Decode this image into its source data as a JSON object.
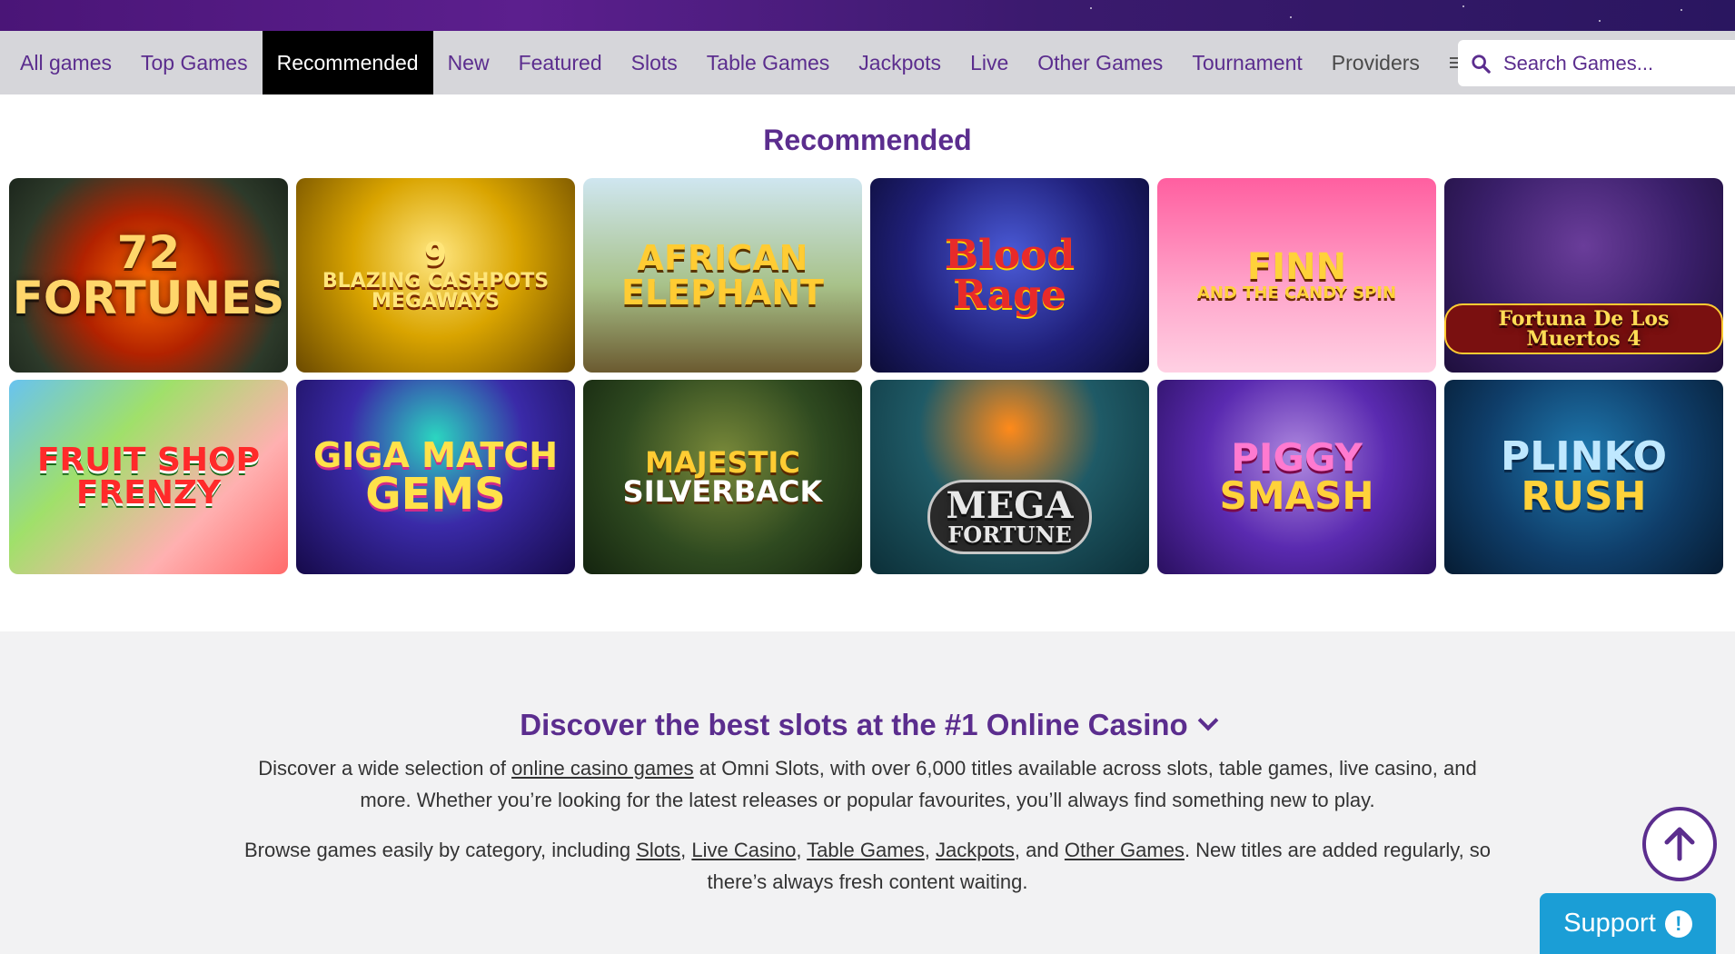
{
  "nav": {
    "items": [
      "All games",
      "Top Games",
      "Recommended",
      "New",
      "Featured",
      "Slots",
      "Table Games",
      "Jackpots",
      "Live",
      "Other Games",
      "Tournament"
    ],
    "active": "Recommended",
    "providers": "Providers"
  },
  "search": {
    "placeholder": "Search Games..."
  },
  "section": {
    "title": "Recommended"
  },
  "games": [
    {
      "title": "72",
      "sub": "FORTUNES"
    },
    {
      "title": "9",
      "sub": "BLAZING CASHPOTS MEGAWAYS"
    },
    {
      "title": "AFRICAN",
      "sub": "ELEPHANT"
    },
    {
      "title": "Blood Rage",
      "sub": ""
    },
    {
      "title": "FINN",
      "sub": "AND THE CANDY SPIN"
    },
    {
      "title": "Fortuna De Los Muertos 4",
      "sub": ""
    },
    {
      "title": "FRUIT SHOP",
      "sub": "FRENZY"
    },
    {
      "title": "GIGA MATCH",
      "sub": "GEMS"
    },
    {
      "title": "MAJESTIC",
      "sub": "SILVERBACK"
    },
    {
      "title": "MEGA",
      "sub": "FORTUNE"
    },
    {
      "title": "PIGGY",
      "sub": "SMASH"
    },
    {
      "title": "PLINKO",
      "sub": "RUSH"
    }
  ],
  "discover": {
    "heading": "Discover the best slots at the #1 Online Casino",
    "p1_a": "Discover a wide selection of ",
    "p1_link": "online casino games",
    "p1_b": " at Omni Slots, with over 6,000 titles available across slots, table games, live casino, and more. Whether you’re looking for the latest releases or popular favourites, you’ll always find something new to play.",
    "p2_a": "Browse games easily by category, including ",
    "p2_links": [
      "Slots",
      "Live Casino",
      "Table Games",
      "Jackpots",
      "Other Games"
    ],
    "p2_sep1": ", ",
    "p2_and": ", and ",
    "p2_b": ". New titles are added regularly, so there’s always fresh content waiting."
  },
  "support": {
    "label": "Support",
    "icon": "!"
  },
  "colors": {
    "brand": "#5b2d8e",
    "support": "#1b9ed6",
    "nav_bg": "#d6d6da"
  }
}
